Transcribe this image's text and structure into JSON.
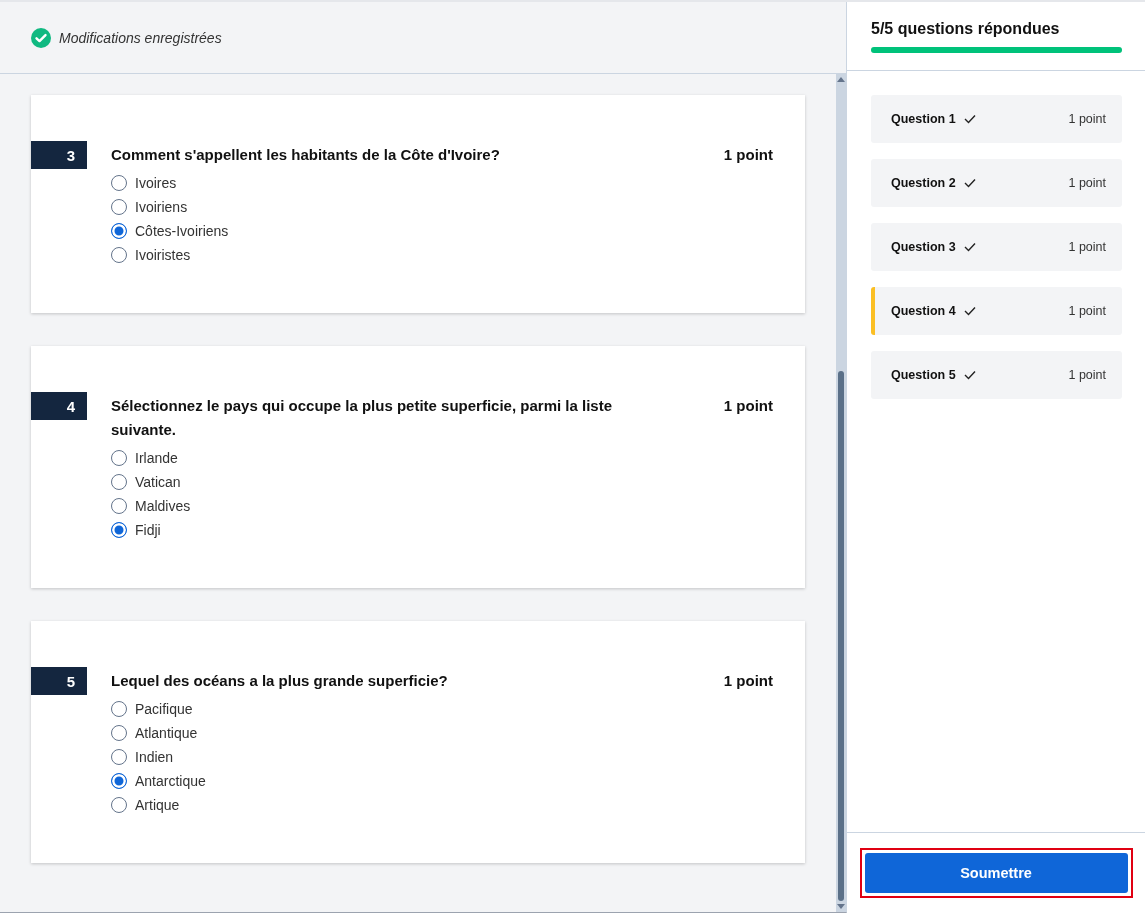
{
  "save_status": {
    "text": "Modifications enregistrées",
    "saved": true
  },
  "questions": [
    {
      "number": "3",
      "text": "Comment s'appellent les habitants de la Côte d'Ivoire?",
      "points": "1 point",
      "options": [
        {
          "label": "Ivoires",
          "selected": false
        },
        {
          "label": "Ivoiriens",
          "selected": false
        },
        {
          "label": "Côtes-Ivoiriens",
          "selected": true
        },
        {
          "label": "Ivoiristes",
          "selected": false
        }
      ]
    },
    {
      "number": "4",
      "text": "Sélectionnez le pays qui occupe la plus petite superficie, parmi la liste suivante.",
      "points": "1 point",
      "options": [
        {
          "label": "Irlande",
          "selected": false
        },
        {
          "label": "Vatican",
          "selected": false
        },
        {
          "label": "Maldives",
          "selected": false
        },
        {
          "label": "Fidji",
          "selected": true
        }
      ]
    },
    {
      "number": "5",
      "text": "Lequel des océans a la plus grande superficie?",
      "points": "1 point",
      "options": [
        {
          "label": "Pacifique",
          "selected": false
        },
        {
          "label": "Atlantique",
          "selected": false
        },
        {
          "label": "Indien",
          "selected": false
        },
        {
          "label": "Antarctique",
          "selected": true
        },
        {
          "label": "Artique",
          "selected": false
        }
      ]
    }
  ],
  "progress": {
    "title": "5/5 questions répondues",
    "level": 1
  },
  "nav": [
    {
      "label": "Question 1",
      "answered": true,
      "points": "1 point",
      "selected": false
    },
    {
      "label": "Question 2",
      "answered": true,
      "points": "1 point",
      "selected": false
    },
    {
      "label": "Question 3",
      "answered": true,
      "points": "1 point",
      "selected": false
    },
    {
      "label": "Question 4",
      "answered": true,
      "points": "1 point",
      "selected": true
    },
    {
      "label": "Question 5",
      "answered": true,
      "points": "1 point",
      "selected": false
    }
  ],
  "submit": {
    "label": "Soumettre",
    "highlighted": true
  }
}
